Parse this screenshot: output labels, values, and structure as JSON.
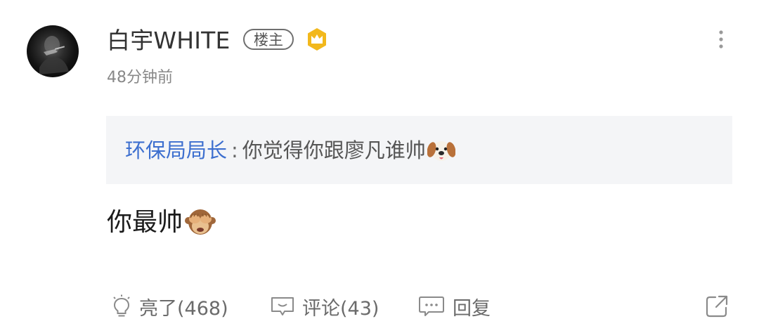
{
  "post": {
    "username": "白宇WHITE",
    "op_badge": "楼主",
    "time": "48分钟前",
    "quote": {
      "author": "环保局局长",
      "separator": ":",
      "text": "你觉得你跟廖凡谁帅"
    },
    "reply": "你最帅"
  },
  "actions": {
    "like_label": "亮了(468)",
    "comment_label": "评论(43)",
    "reply_label": "回复"
  },
  "icons": {
    "avatar": "user-avatar",
    "crown": "crown-badge-icon",
    "more": "more-vertical-icon",
    "like": "lightbulb-icon",
    "comment": "comment-icon",
    "reply": "reply-bubble-icon",
    "share": "share-icon",
    "emoji_dog": "dog-face-emoji",
    "emoji_monkey": "see-no-evil-monkey-emoji"
  },
  "colors": {
    "quote_author": "#3d6fcf",
    "crown_badge": "#f2b81c",
    "quote_background": "#f4f5f7",
    "meta_text": "#888888"
  }
}
